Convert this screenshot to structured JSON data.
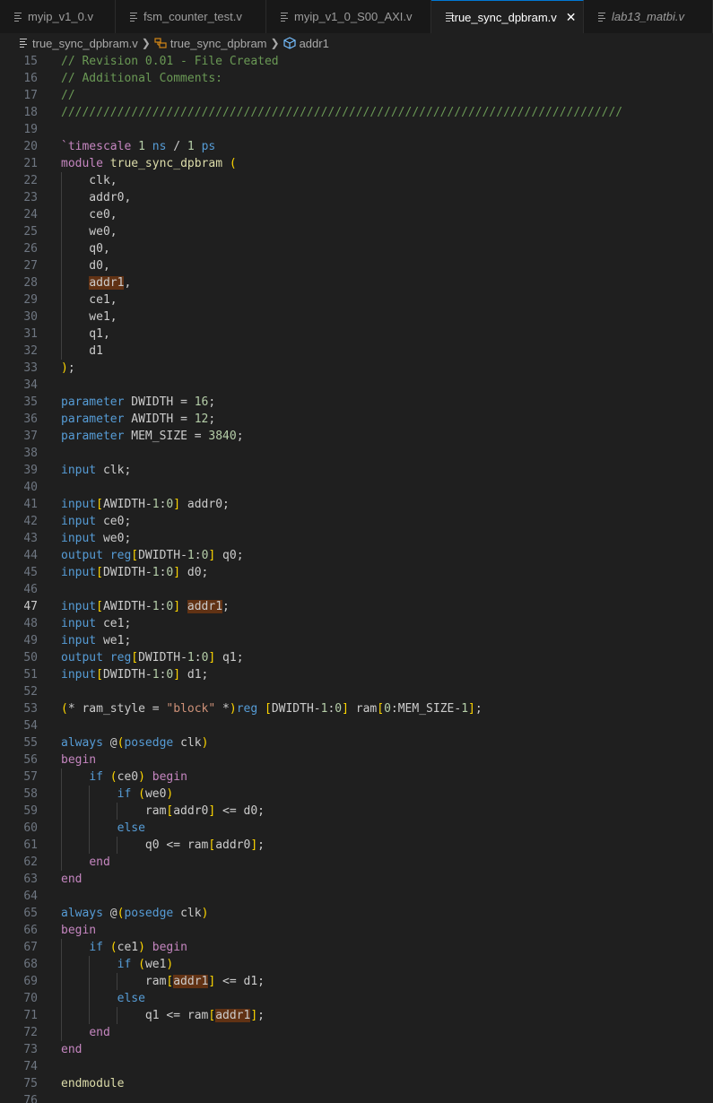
{
  "tabs": [
    {
      "label": "myip_v1_0.v",
      "active": false,
      "italic": false
    },
    {
      "label": "fsm_counter_test.v",
      "active": false,
      "italic": false
    },
    {
      "label": "myip_v1_0_S00_AXI.v",
      "active": false,
      "italic": false
    },
    {
      "label": "true_sync_dpbram.v",
      "active": true,
      "italic": false
    },
    {
      "label": "lab13_matbi.v",
      "active": false,
      "italic": true
    }
  ],
  "breadcrumb": {
    "file": "true_sync_dpbram.v",
    "module": "true_sync_dpbram",
    "symbol": "addr1"
  },
  "editor": {
    "current_line": 47,
    "highlight_word": "addr1",
    "lines": [
      {
        "n": "15",
        "t": "// Revision 0.01 - File Created"
      },
      {
        "n": "16",
        "t": "// Additional Comments:"
      },
      {
        "n": "17",
        "t": "//"
      },
      {
        "n": "18",
        "t": "////////////////////////////////////////////////////////////////////////////////"
      },
      {
        "n": "19",
        "t": ""
      },
      {
        "n": "20",
        "t": "`timescale 1 ns / 1 ps"
      },
      {
        "n": "21",
        "t": "module true_sync_dpbram ("
      },
      {
        "n": "22",
        "t": "    clk,"
      },
      {
        "n": "23",
        "t": "    addr0,"
      },
      {
        "n": "24",
        "t": "    ce0,"
      },
      {
        "n": "25",
        "t": "    we0,"
      },
      {
        "n": "26",
        "t": "    q0,"
      },
      {
        "n": "27",
        "t": "    d0,"
      },
      {
        "n": "28",
        "t": "    addr1,"
      },
      {
        "n": "29",
        "t": "    ce1,"
      },
      {
        "n": "30",
        "t": "    we1,"
      },
      {
        "n": "31",
        "t": "    q1,"
      },
      {
        "n": "32",
        "t": "    d1"
      },
      {
        "n": "33",
        "t": ");"
      },
      {
        "n": "34",
        "t": ""
      },
      {
        "n": "35",
        "t": "parameter DWIDTH = 16;"
      },
      {
        "n": "36",
        "t": "parameter AWIDTH = 12;"
      },
      {
        "n": "37",
        "t": "parameter MEM_SIZE = 3840;"
      },
      {
        "n": "38",
        "t": ""
      },
      {
        "n": "39",
        "t": "input clk;"
      },
      {
        "n": "40",
        "t": ""
      },
      {
        "n": "41",
        "t": "input[AWIDTH-1:0] addr0;"
      },
      {
        "n": "42",
        "t": "input ce0;"
      },
      {
        "n": "43",
        "t": "input we0;"
      },
      {
        "n": "44",
        "t": "output reg[DWIDTH-1:0] q0;"
      },
      {
        "n": "45",
        "t": "input[DWIDTH-1:0] d0;"
      },
      {
        "n": "46",
        "t": ""
      },
      {
        "n": "47",
        "t": "input[AWIDTH-1:0] addr1;"
      },
      {
        "n": "48",
        "t": "input ce1;"
      },
      {
        "n": "49",
        "t": "input we1;"
      },
      {
        "n": "50",
        "t": "output reg[DWIDTH-1:0] q1;"
      },
      {
        "n": "51",
        "t": "input[DWIDTH-1:0] d1;"
      },
      {
        "n": "52",
        "t": ""
      },
      {
        "n": "53",
        "t": "(* ram_style = \"block\" *)reg [DWIDTH-1:0] ram[0:MEM_SIZE-1];"
      },
      {
        "n": "54",
        "t": ""
      },
      {
        "n": "55",
        "t": "always @(posedge clk)"
      },
      {
        "n": "56",
        "t": "begin"
      },
      {
        "n": "57",
        "t": "    if (ce0) begin"
      },
      {
        "n": "58",
        "t": "        if (we0)"
      },
      {
        "n": "59",
        "t": "            ram[addr0] <= d0;"
      },
      {
        "n": "60",
        "t": "        else"
      },
      {
        "n": "61",
        "t": "            q0 <= ram[addr0];"
      },
      {
        "n": "62",
        "t": "    end"
      },
      {
        "n": "63",
        "t": "end"
      },
      {
        "n": "64",
        "t": ""
      },
      {
        "n": "65",
        "t": "always @(posedge clk)"
      },
      {
        "n": "66",
        "t": "begin"
      },
      {
        "n": "67",
        "t": "    if (ce1) begin"
      },
      {
        "n": "68",
        "t": "        if (we1)"
      },
      {
        "n": "69",
        "t": "            ram[addr1] <= d1;"
      },
      {
        "n": "70",
        "t": "        else"
      },
      {
        "n": "71",
        "t": "            q1 <= ram[addr1];"
      },
      {
        "n": "72",
        "t": "    end"
      },
      {
        "n": "73",
        "t": "end"
      },
      {
        "n": "74",
        "t": ""
      },
      {
        "n": "75",
        "t": "endmodule"
      },
      {
        "n": "76",
        "t": ""
      }
    ]
  },
  "colors": {
    "background": "#1f1f1f",
    "tabbar": "#181818",
    "active_tab_border": "#0078d4",
    "comment": "#6a9955",
    "keyword": "#569cd6",
    "control": "#c586c0",
    "type_name": "#dcdcaa",
    "number": "#b5cea8",
    "string": "#ce9178",
    "highlight": "#613214"
  },
  "icons": {
    "tab_file": "file-lines-icon",
    "close": "close-icon",
    "breadcrumb_separator": "chevron-right-icon",
    "module": "module-icon",
    "symbol": "variable-cube-icon"
  }
}
